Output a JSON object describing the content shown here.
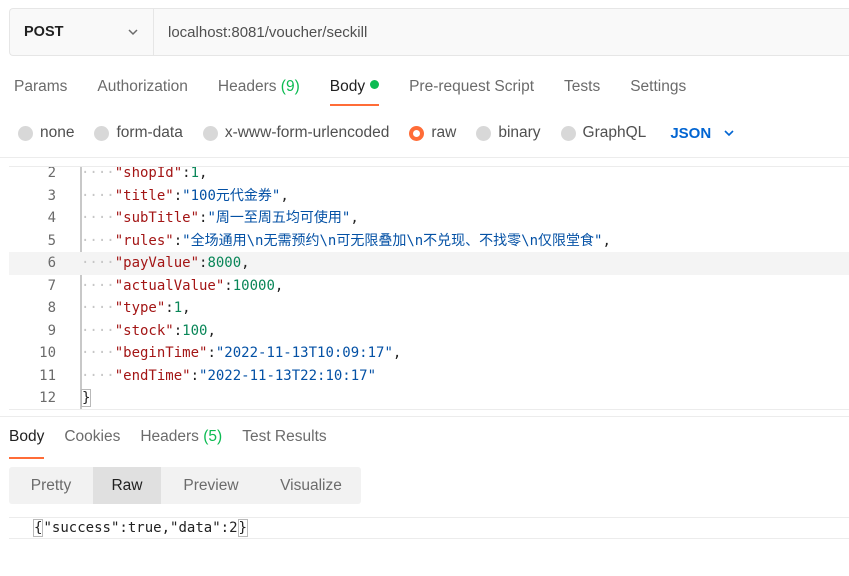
{
  "request": {
    "method": "POST",
    "url": "localhost:8081/voucher/seckill"
  },
  "request_tabs": [
    {
      "label": "Params"
    },
    {
      "label": "Authorization"
    },
    {
      "label": "Headers",
      "count": "(9)"
    },
    {
      "label": "Body",
      "active": true
    },
    {
      "label": "Pre-request Script"
    },
    {
      "label": "Tests"
    },
    {
      "label": "Settings"
    }
  ],
  "body_types": [
    {
      "label": "none"
    },
    {
      "label": "form-data"
    },
    {
      "label": "x-www-form-urlencoded"
    },
    {
      "label": "raw",
      "selected": true
    },
    {
      "label": "binary"
    },
    {
      "label": "GraphQL"
    }
  ],
  "body_format": "JSON",
  "code_lines": [
    {
      "num": "2",
      "key": "shopId",
      "value": "1",
      "vtype": "n",
      "partial": true
    },
    {
      "num": "3",
      "key": "title",
      "value": "\"100元代金券\"",
      "vtype": "s"
    },
    {
      "num": "4",
      "key": "subTitle",
      "value": "\"周一至周五均可使用\"",
      "vtype": "s"
    },
    {
      "num": "5",
      "key": "rules",
      "value": "\"全场通用\\n无需预约\\n可无限叠加\\n不兑现、不找零\\n仅限堂食\"",
      "vtype": "s"
    },
    {
      "num": "6",
      "key": "payValue",
      "value": "8000",
      "vtype": "n",
      "highlight": true
    },
    {
      "num": "7",
      "key": "actualValue",
      "value": "10000",
      "vtype": "n"
    },
    {
      "num": "8",
      "key": "type",
      "value": "1",
      "vtype": "n"
    },
    {
      "num": "9",
      "key": "stock",
      "value": "100",
      "vtype": "n"
    },
    {
      "num": "10",
      "key": "beginTime",
      "value": "\"2022-11-13T10:09:17\"",
      "vtype": "s"
    },
    {
      "num": "11",
      "key": "endTime",
      "value": "\"2022-11-13T22:10:17\"",
      "vtype": "s",
      "last": true
    },
    {
      "num": "12",
      "brace": "}"
    }
  ],
  "response_tabs": [
    {
      "label": "Body",
      "active": true
    },
    {
      "label": "Cookies"
    },
    {
      "label": "Headers",
      "count": "(5)"
    },
    {
      "label": "Test Results"
    }
  ],
  "view_modes": [
    {
      "label": "Pretty"
    },
    {
      "label": "Raw",
      "active": true
    },
    {
      "label": "Preview"
    },
    {
      "label": "Visualize"
    }
  ],
  "response_body": "{\"success\":true,\"data\":2}",
  "colors": {
    "accent": "#ff6c37",
    "success": "#0cbb52",
    "link": "#0265d2"
  }
}
